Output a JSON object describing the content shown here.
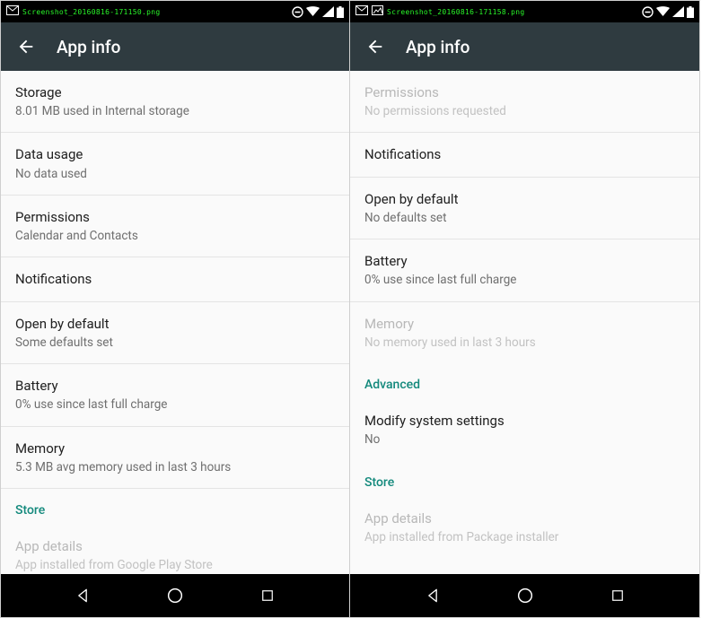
{
  "left": {
    "statusFilename": "Screenshot_20160816-171150.png",
    "toolbar": {
      "title": "App info"
    },
    "rows": [
      {
        "title": "Storage",
        "sub": "8.01 MB used in Internal storage",
        "dim": false
      },
      {
        "title": "Data usage",
        "sub": "No data used",
        "dim": false
      },
      {
        "title": "Permissions",
        "sub": "Calendar and Contacts",
        "dim": false
      },
      {
        "title": "Notifications",
        "sub": "",
        "dim": false
      },
      {
        "title": "Open by default",
        "sub": "Some defaults set",
        "dim": false
      },
      {
        "title": "Battery",
        "sub": "0% use since last full charge",
        "dim": false
      },
      {
        "title": "Memory",
        "sub": "5.3 MB avg memory used in last 3 hours",
        "dim": false
      }
    ],
    "sectionHeader": "Store",
    "appDetails": {
      "title": "App details",
      "sub": "App installed from Google Play Store"
    }
  },
  "right": {
    "statusFilename": "Screenshot_20160816-171158.png",
    "toolbar": {
      "title": "App info"
    },
    "rows": [
      {
        "title": "Permissions",
        "sub": "No permissions requested",
        "dim": true
      },
      {
        "title": "Notifications",
        "sub": "",
        "dim": false
      },
      {
        "title": "Open by default",
        "sub": "No defaults set",
        "dim": false
      },
      {
        "title": "Battery",
        "sub": "0% use since last full charge",
        "dim": false
      },
      {
        "title": "Memory",
        "sub": "No memory used in last 3 hours",
        "dim": true
      }
    ],
    "sectionHeader1": "Advanced",
    "modify": {
      "title": "Modify system settings",
      "sub": "No"
    },
    "sectionHeader2": "Store",
    "appDetails": {
      "title": "App details",
      "sub": "App installed from Package installer"
    }
  }
}
